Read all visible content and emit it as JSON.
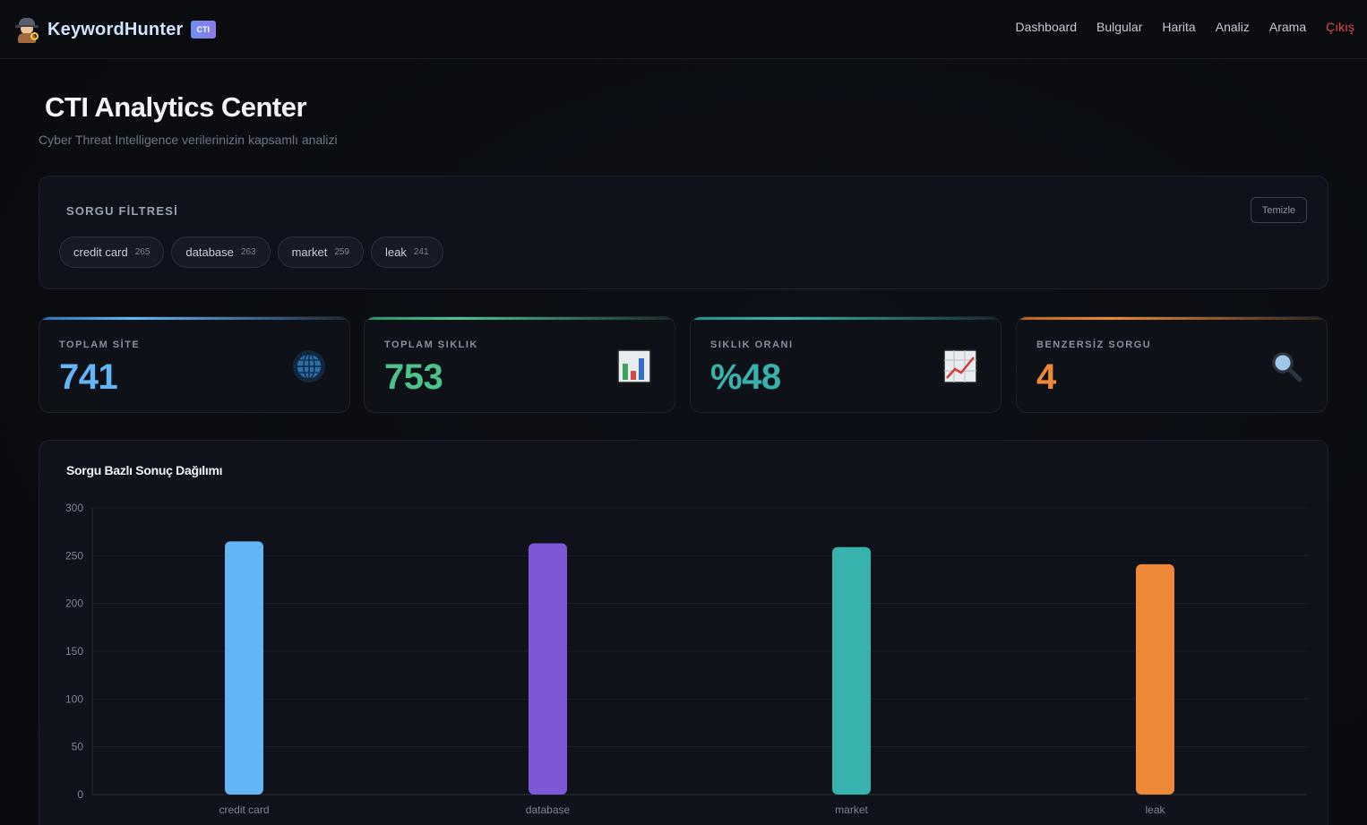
{
  "nav": {
    "brand": "KeywordHunter",
    "badge": "CTI",
    "links": [
      "Dashboard",
      "Bulgular",
      "Harita",
      "Analiz",
      "Arama"
    ],
    "logout": "Çıkış"
  },
  "header": {
    "title": "CTI Analytics Center",
    "subtitle": "Cyber Threat Intelligence verilerinizin kapsamlı analizi"
  },
  "filter": {
    "title": "SORGU FİLTRESİ",
    "clear_label": "Temizle",
    "chips": [
      {
        "label": "credit card",
        "count": "265"
      },
      {
        "label": "database",
        "count": "263"
      },
      {
        "label": "market",
        "count": "259"
      },
      {
        "label": "leak",
        "count": "241"
      }
    ]
  },
  "stats": [
    {
      "label": "TOPLAM SİTE",
      "value": "741",
      "icon": "globe-icon",
      "color": "#64b5f6"
    },
    {
      "label": "TOPLAM SIKLIK",
      "value": "753",
      "icon": "bar-chart-icon",
      "color": "#4cc38a"
    },
    {
      "label": "SIKLIK ORANI",
      "value": "%48",
      "icon": "trend-chart-icon",
      "color": "#38b2ac"
    },
    {
      "label": "BENZERSİZ SORGU",
      "value": "4",
      "icon": "magnifier-icon",
      "color": "#ed8936"
    }
  ],
  "chart_data": {
    "type": "bar",
    "title": "Sorgu Bazlı Sonuç Dağılımı",
    "categories": [
      "credit card",
      "database",
      "market",
      "leak"
    ],
    "values": [
      265,
      263,
      259,
      241
    ],
    "colors": [
      "#64b5f6",
      "#7e57d6",
      "#38b2ac",
      "#ed8936"
    ],
    "ylim": [
      0,
      300
    ],
    "yticks": [
      0,
      50,
      100,
      150,
      200,
      250,
      300
    ],
    "grid": true,
    "xlabel": "",
    "ylabel": ""
  }
}
